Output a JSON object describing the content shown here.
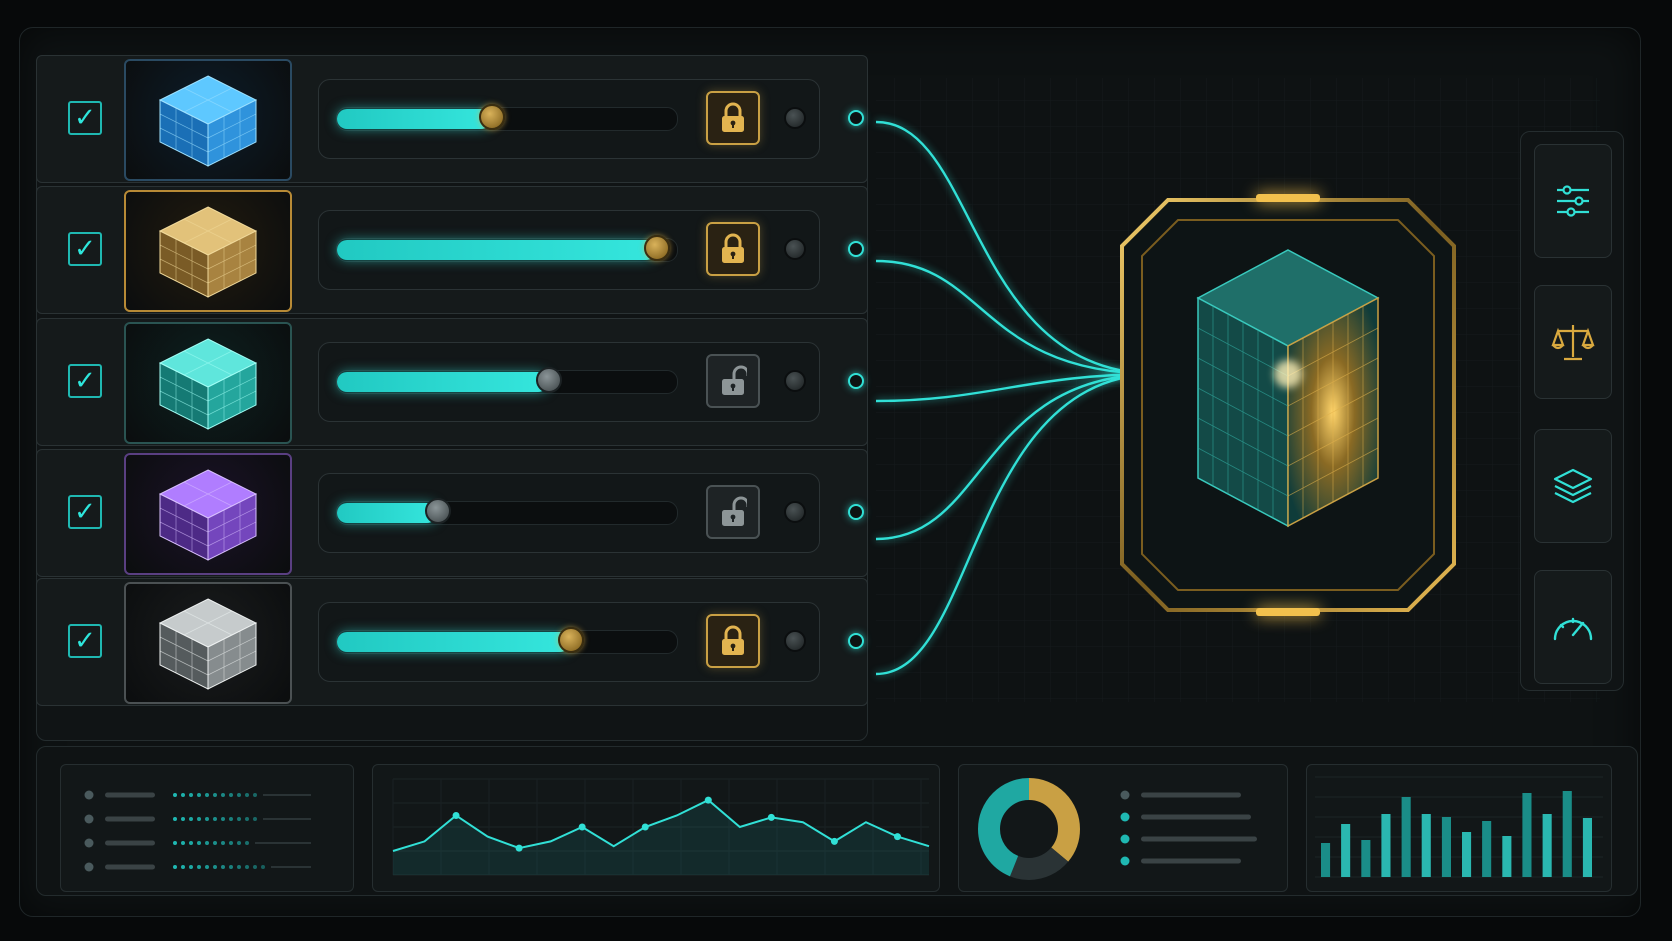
{
  "colors": {
    "accent_cyan": "#31e0d6",
    "accent_gold": "#d9a93f",
    "background": "#07090a",
    "panel": "#101415"
  },
  "sources": [
    {
      "checked": true,
      "checkmark": "✓",
      "cube_color": "blue",
      "slider_value": 0.45,
      "knob_style": "gold",
      "locked": true,
      "lock_icon": "lock-icon"
    },
    {
      "checked": true,
      "checkmark": "✓",
      "cube_color": "gold",
      "slider_value": 0.97,
      "knob_style": "gold",
      "locked": true,
      "lock_icon": "lock-icon"
    },
    {
      "checked": true,
      "checkmark": "✓",
      "cube_color": "teal",
      "slider_value": 0.63,
      "knob_style": "grey",
      "locked": false,
      "lock_icon": "unlock-icon"
    },
    {
      "checked": true,
      "checkmark": "✓",
      "cube_color": "purple",
      "slider_value": 0.28,
      "knob_style": "grey",
      "locked": false,
      "lock_icon": "unlock-icon"
    },
    {
      "checked": true,
      "checkmark": "✓",
      "cube_color": "silver",
      "slider_value": 0.7,
      "knob_style": "gold",
      "locked": true,
      "lock_icon": "lock-icon"
    }
  ],
  "toolbar": [
    {
      "icon": "sliders-icon"
    },
    {
      "icon": "scale-icon"
    },
    {
      "icon": "layers-icon"
    },
    {
      "icon": "gauge-icon"
    }
  ],
  "output": {
    "icon": "merged-cube-icon"
  },
  "line_chart": {
    "type": "line",
    "values": [
      0.25,
      0.35,
      0.62,
      0.4,
      0.28,
      0.35,
      0.5,
      0.3,
      0.5,
      0.62,
      0.78,
      0.5,
      0.6,
      0.55,
      0.35,
      0.55,
      0.4,
      0.3
    ]
  },
  "donut_chart": {
    "type": "pie",
    "slices": [
      {
        "value": 0.36,
        "color": "#c9a044"
      },
      {
        "value": 0.2,
        "color": "#2a3335"
      },
      {
        "value": 0.44,
        "color": "#1fa8a2"
      }
    ]
  },
  "bar_chart": {
    "type": "bar",
    "values": [
      0.34,
      0.53,
      0.37,
      0.63,
      0.8,
      0.63,
      0.6,
      0.45,
      0.56,
      0.41,
      0.84,
      0.63,
      0.86,
      0.59
    ]
  }
}
